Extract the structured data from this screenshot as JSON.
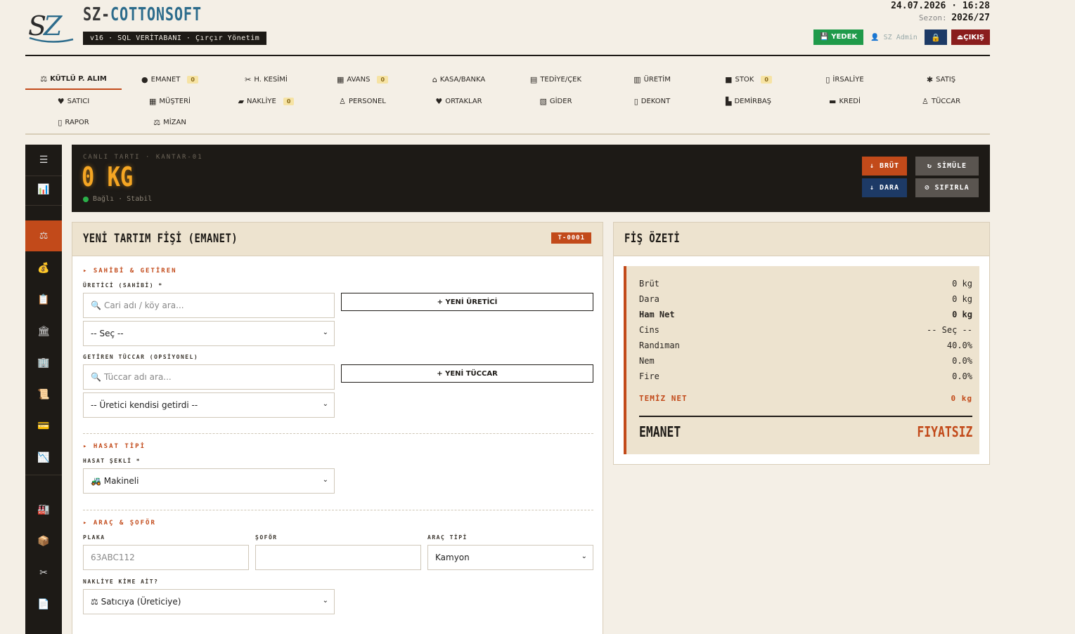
{
  "header": {
    "brand_prefix": "SZ-",
    "brand_name": "COTTONSOFT",
    "subtitle": "v16 · SQL VERİTABANI · Çırçır Yönetim",
    "datetime": "24.07.2026 · 16:28",
    "season_label": "Sezon:",
    "season_value": "2026/27",
    "backup_label": "YEDEK",
    "admin_label": "SZ Admin",
    "logout_label": "ÇIKIŞ"
  },
  "nav": [
    {
      "label": "KÜTLÜ P. ALIM",
      "icon": "⚖"
    },
    {
      "label": "EMANET",
      "icon": "●",
      "count": "0"
    },
    {
      "label": "H. KESİMİ",
      "icon": "✂"
    },
    {
      "label": "AVANS",
      "icon": "▦",
      "count": "0"
    },
    {
      "label": "KASA/BANKA",
      "icon": "⌂"
    },
    {
      "label": "TEDİYE/ÇEK",
      "icon": "▤"
    },
    {
      "label": "ÜRETİM",
      "icon": "▥"
    },
    {
      "label": "STOK",
      "icon": "■",
      "count": "0"
    },
    {
      "label": "İRSALİYE",
      "icon": "▯"
    },
    {
      "label": "SATIŞ",
      "icon": "✱"
    },
    {
      "label": "SATICI",
      "icon": "♥"
    },
    {
      "label": "MÜŞTERİ",
      "icon": "▦"
    },
    {
      "label": "NAKLİYE",
      "icon": "▰",
      "count": "0"
    },
    {
      "label": "PERSONEL",
      "icon": "♙"
    },
    {
      "label": "ORTAKLAR",
      "icon": "♥"
    },
    {
      "label": "GİDER",
      "icon": "▧"
    },
    {
      "label": "DEKONT",
      "icon": "▯"
    },
    {
      "label": "DEMİRBAŞ",
      "icon": "▙"
    },
    {
      "label": "KREDİ",
      "icon": "▬"
    },
    {
      "label": "TÜCCAR",
      "icon": "♙"
    },
    {
      "label": "RAPOR",
      "icon": "▯"
    },
    {
      "label": "MİZAN",
      "icon": "⚖"
    }
  ],
  "scale": {
    "label": "CANLI TARTI · KANTAR-01",
    "value": "0 KG",
    "status": "Bağlı · Stabil",
    "buttons": {
      "brut": "↓ BRÜT",
      "dara": "↓ DARA",
      "simule": "↻ SİMÜLE",
      "sifirla": "⊘ SIFIRLA"
    }
  },
  "form": {
    "title": "YENİ TARTIM FİŞİ (EMANET)",
    "ticket_no": "T-0001",
    "sec_owner": "▸ SAHİBİ & GETİREN",
    "producer_label": "ÜRETİCİ (SAHİBİ) *",
    "producer_search_placeholder": "Cari adı / köy ara...",
    "producer_select": "-- Seç --",
    "new_producer": "+ YENİ ÜRETİCİ",
    "trader_label": "GETİREN TÜCCAR (OPSİYONEL)",
    "trader_search_placeholder": "Tüccar adı ara...",
    "trader_select": "-- Üretici kendisi getirdi --",
    "new_trader": "+ YENİ TÜCCAR",
    "sec_harvest": "▸ HASAT TİPİ",
    "harvest_label": "HASAT ŞEKLİ *",
    "harvest_value": "🚜 Makineli",
    "sec_vehicle": "▸ ARAÇ & ŞOFÖR",
    "plate_label": "PLAKA",
    "plate_placeholder": "63ABC112",
    "driver_label": "ŞOFÖR",
    "vehicle_type_label": "ARAÇ TİPİ",
    "vehicle_type_value": "Kamyon",
    "shipping_label": "NAKLİYE KİME AİT?",
    "shipping_value": "⚖ Satıcıya (Üreticiye)"
  },
  "summary": {
    "title": "FİŞ ÖZETİ",
    "rows": [
      {
        "label": "Brüt",
        "value": "0 kg"
      },
      {
        "label": "Dara",
        "value": "0 kg"
      },
      {
        "label": "Ham Net",
        "value": "0 kg"
      },
      {
        "label": "Cins",
        "value": "-- Seç --"
      },
      {
        "label": "Randıman",
        "value": "40.0%"
      },
      {
        "label": "Nem",
        "value": "0.0%"
      },
      {
        "label": "Fire",
        "value": "0.0%"
      }
    ],
    "clean_net_label": "TEMİZ NET",
    "clean_net_value": "0 kg",
    "type_label": "EMANET",
    "price_label": "FIYATSIZ"
  },
  "rail": [
    "☰",
    "📊",
    "⚖",
    "💰",
    "📋",
    "🏛",
    "🏢",
    "📜",
    "💳",
    "📉",
    "🏭",
    "📦",
    "✂",
    "📄"
  ],
  "colors": {
    "accent": "#c24a1a",
    "dark": "#1d1a16",
    "cream": "#f4efe6",
    "panel": "#ede3cf",
    "scale_amber": "#f5a623",
    "ok_green": "#1f9a4a",
    "navy": "#1d3a66",
    "logout_red": "#8a1d1d"
  }
}
